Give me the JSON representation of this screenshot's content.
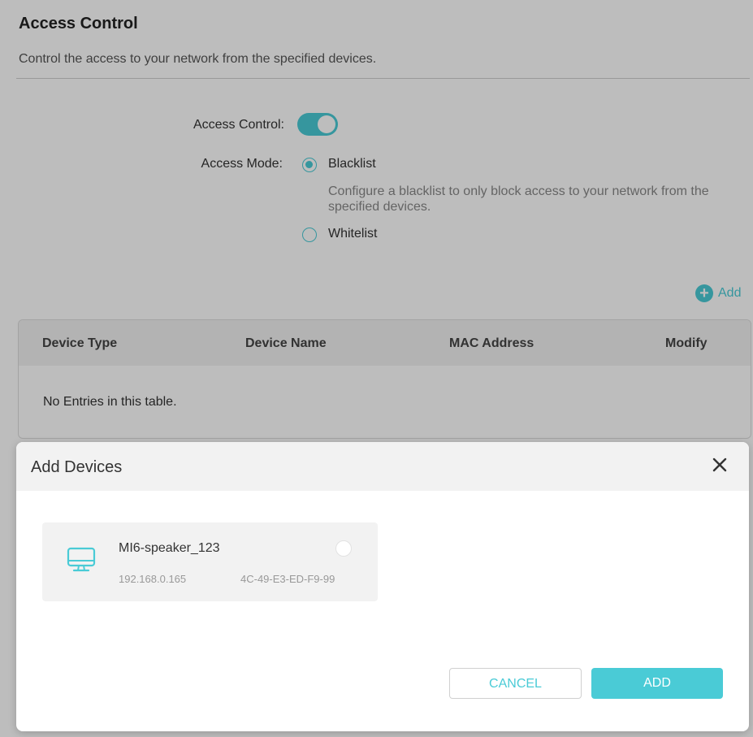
{
  "page": {
    "title": "Access Control",
    "subtitle": "Control the access to your network from the specified devices.",
    "access_control_label": "Access Control:",
    "access_control_enabled": true,
    "access_mode_label": "Access Mode:",
    "mode_options": [
      {
        "label": "Blacklist",
        "checked": true
      },
      {
        "label": "Whitelist",
        "checked": false
      }
    ],
    "blacklist_hint": "Configure a blacklist to only block access to your network from the specified devices.",
    "add_label": "Add",
    "table": {
      "columns": [
        "Device Type",
        "Device Name",
        "MAC Address",
        "Modify"
      ],
      "empty_text": "No Entries in this table."
    }
  },
  "modal": {
    "title": "Add Devices",
    "devices": [
      {
        "name": "MI6-speaker_123",
        "ip": "192.168.0.165",
        "mac": "4C-49-E3-ED-F9-99",
        "icon": "monitor-icon",
        "selected": false
      }
    ],
    "cancel_label": "CANCEL",
    "add_label": "ADD"
  },
  "colors": {
    "accent": "#4acbd6",
    "overlay": "rgba(0,0,0,0.26)",
    "header_bg": "#f2f2f2"
  }
}
